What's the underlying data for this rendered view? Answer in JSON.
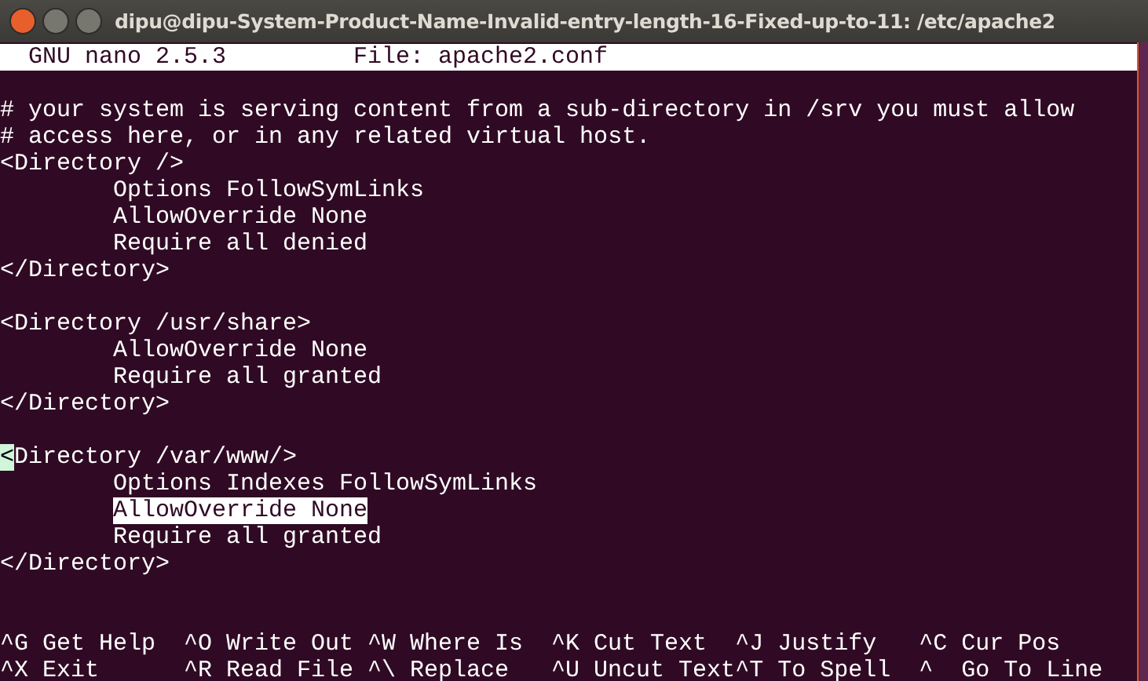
{
  "window": {
    "title": "dipu@dipu-System-Product-Name-Invalid-entry-length-16-Fixed-up-to-11: /etc/apache2"
  },
  "header": {
    "version": "GNU nano 2.5.3",
    "file": "File: apache2.conf"
  },
  "lines": [
    {
      "kind": "blank"
    },
    {
      "kind": "text",
      "text": "# your system is serving content from a sub-directory in /srv you must allow",
      "indent": false,
      "marked": false,
      "cursor": false
    },
    {
      "kind": "text",
      "text": "# access here, or in any related virtual host.",
      "indent": false,
      "marked": false,
      "cursor": false
    },
    {
      "kind": "text",
      "text": "<Directory />",
      "indent": false,
      "marked": false,
      "cursor": false
    },
    {
      "kind": "text",
      "text": "Options FollowSymLinks",
      "indent": true,
      "marked": false,
      "cursor": false
    },
    {
      "kind": "text",
      "text": "AllowOverride None",
      "indent": true,
      "marked": false,
      "cursor": false
    },
    {
      "kind": "text",
      "text": "Require all denied",
      "indent": true,
      "marked": false,
      "cursor": false
    },
    {
      "kind": "text",
      "text": "</Directory>",
      "indent": false,
      "marked": false,
      "cursor": false
    },
    {
      "kind": "blank"
    },
    {
      "kind": "text",
      "text": "<Directory /usr/share>",
      "indent": false,
      "marked": false,
      "cursor": false
    },
    {
      "kind": "text",
      "text": "AllowOverride None",
      "indent": true,
      "marked": false,
      "cursor": false
    },
    {
      "kind": "text",
      "text": "Require all granted",
      "indent": true,
      "marked": false,
      "cursor": false
    },
    {
      "kind": "text",
      "text": "</Directory>",
      "indent": false,
      "marked": false,
      "cursor": false
    },
    {
      "kind": "blank"
    },
    {
      "kind": "text",
      "text": "<Directory /var/www/>",
      "indent": false,
      "marked": false,
      "cursor": true
    },
    {
      "kind": "text",
      "text": "Options Indexes FollowSymLinks",
      "indent": true,
      "marked": false,
      "cursor": false
    },
    {
      "kind": "text",
      "text": "AllowOverride None",
      "indent": true,
      "marked": true,
      "cursor": false
    },
    {
      "kind": "text",
      "text": "Require all granted",
      "indent": true,
      "marked": false,
      "cursor": false
    },
    {
      "kind": "text",
      "text": "</Directory>",
      "indent": false,
      "marked": false,
      "cursor": false
    },
    {
      "kind": "blank"
    },
    {
      "kind": "blank"
    }
  ],
  "shortcuts": [
    {
      "key": "^G",
      "label": "Get Help"
    },
    {
      "key": "^O",
      "label": "Write Out"
    },
    {
      "key": "^W",
      "label": "Where Is"
    },
    {
      "key": "^K",
      "label": "Cut Text"
    },
    {
      "key": "^J",
      "label": "Justify"
    },
    {
      "key": "^C",
      "label": "Cur Pos"
    },
    {
      "key": "^X",
      "label": "Exit"
    },
    {
      "key": "^R",
      "label": "Read File"
    },
    {
      "key": "^\\",
      "label": "Replace"
    },
    {
      "key": "^U",
      "label": "Uncut Text"
    },
    {
      "key": "^T",
      "label": "To Spell"
    },
    {
      "key": "^",
      "label": "Go To Line"
    }
  ]
}
